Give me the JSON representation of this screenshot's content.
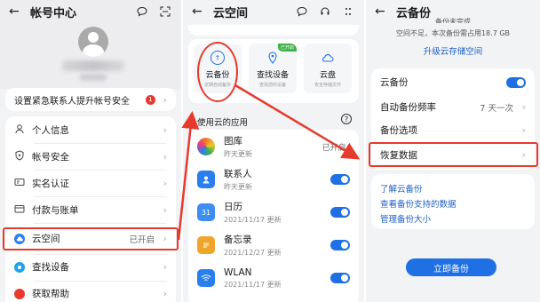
{
  "panel1": {
    "title": "帐号中心",
    "emergency": "设置紧急联系人提升帐号安全",
    "emergency_badge": "1",
    "items": [
      {
        "label": "个人信息",
        "icon": "person-icon"
      },
      {
        "label": "帐号安全",
        "icon": "shield-icon"
      },
      {
        "label": "实名认证",
        "icon": "id-card-icon"
      },
      {
        "label": "付款与账单",
        "icon": "wallet-icon"
      },
      {
        "label": "云空间",
        "icon": "cloud-icon",
        "value": "已开启"
      },
      {
        "label": "查找设备",
        "icon": "find-device-icon"
      },
      {
        "label": "获取帮助",
        "icon": "help-icon"
      }
    ]
  },
  "panel2": {
    "title": "云空间",
    "services": [
      {
        "name": "云备份",
        "sub": "定期自动备份",
        "badge": ""
      },
      {
        "name": "查找设备",
        "sub": "查找您的设备",
        "badge": "已开启"
      },
      {
        "name": "云盘",
        "sub": "安全存储文件",
        "badge": ""
      }
    ],
    "apps_header": "使用云的应用",
    "apps": [
      {
        "name": "图库",
        "date": "昨天更新",
        "status": "已开启",
        "color": "#f07c2a"
      },
      {
        "name": "联系人",
        "date": "昨天更新",
        "status": "",
        "color": "#2a7ef0"
      },
      {
        "name": "日历",
        "date": "2021/11/17 更新",
        "status": "",
        "color": "#3d8ef0",
        "glyph": "31"
      },
      {
        "name": "备忘录",
        "date": "2021/12/27 更新",
        "status": "",
        "color": "#f0a52a"
      },
      {
        "name": "WLAN",
        "date": "2021/11/17 更新",
        "status": "",
        "color": "#2a7ef0"
      }
    ]
  },
  "panel3": {
    "title": "云备份",
    "partial_top": "备份未完成",
    "notice": "空间不足，本次备份需占用18.7 GB",
    "upgrade": "升级云存储空间",
    "rows": [
      {
        "label": "云备份",
        "value": ""
      },
      {
        "label": "自动备份频率",
        "value": "7 天一次"
      },
      {
        "label": "备份选项",
        "value": ""
      },
      {
        "label": "恢复数据",
        "value": ""
      }
    ],
    "links": [
      "了解云备份",
      "查看备份支持的数据",
      "管理备份大小"
    ],
    "backup_button": "立即备份"
  },
  "colors": {
    "accent": "#1f6fe5",
    "highlight": "#e63a2e"
  }
}
